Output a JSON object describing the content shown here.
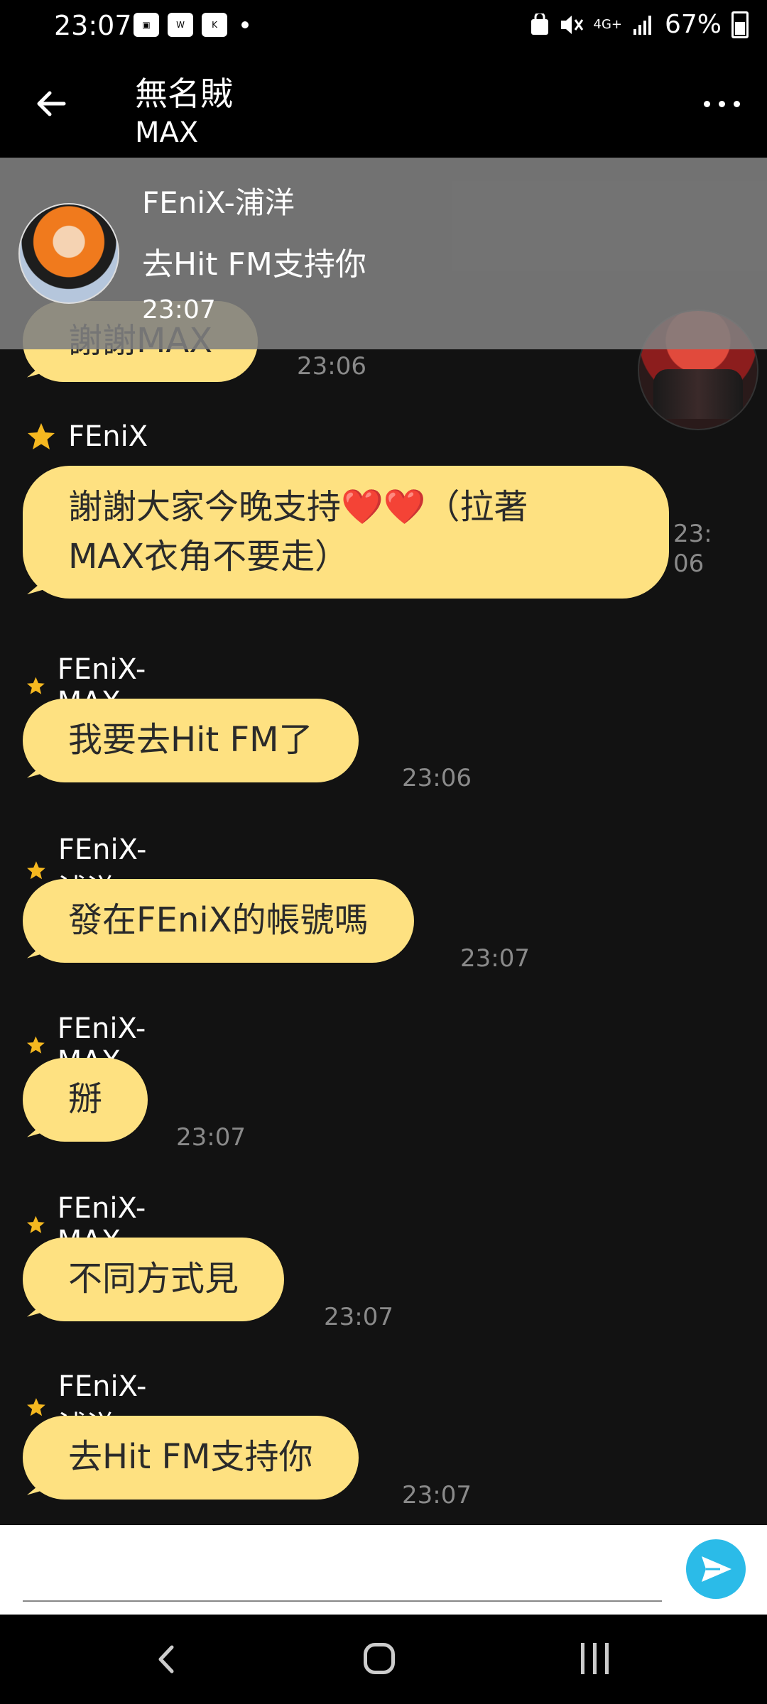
{
  "status_bar": {
    "time": "23:07",
    "battery": "67%",
    "network": "4G+"
  },
  "header": {
    "title": "無名賊",
    "subtitle": "MAX"
  },
  "notification": {
    "sender": "FEniX-浦洋",
    "text": "去Hit FM支持你",
    "time": "23:07"
  },
  "messages": [
    {
      "sender": "",
      "text": "謝謝MAX",
      "time": "23:06"
    },
    {
      "sender": "FEniX",
      "text_line1": "謝謝大家今晚支持❤️❤️（拉著",
      "text_line2": "MAX衣角不要走）",
      "time_line1": "23:",
      "time_line2": "06"
    },
    {
      "sender": "FEniX-MAX",
      "text": "我要去Hit FM了",
      "time": "23:06"
    },
    {
      "sender": "FEniX-浦洋",
      "text": "發在FEniX的帳號嗎",
      "time": "23:07"
    },
    {
      "sender": "FEniX-MAX",
      "text": "掰",
      "time": "23:07"
    },
    {
      "sender": "FEniX-MAX",
      "text": "不同方式見",
      "time": "23:07"
    },
    {
      "sender": "FEniX-浦洋",
      "text": "去Hit FM支持你",
      "time": "23:07"
    }
  ],
  "input": {
    "placeholder": ""
  },
  "colors": {
    "bubble": "#fee181",
    "star": "#f5b820",
    "send": "#2bbbe8",
    "background": "#121212"
  }
}
